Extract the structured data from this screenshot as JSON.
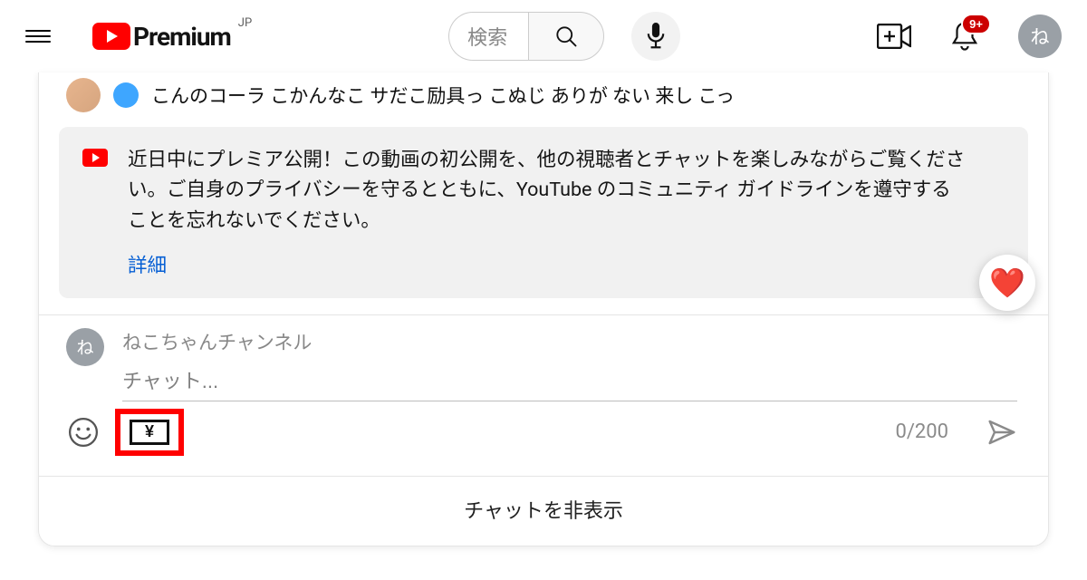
{
  "header": {
    "premium_text": "Premium",
    "region_tag": "JP",
    "search_placeholder": "検索",
    "notification_badge": "9+",
    "avatar_letter": "ね"
  },
  "chat": {
    "peek_message": "こんのコーラ こかんなこ サだこ励具っ こぬじ ありが ない 来し こっ",
    "notice_text": "近日中にプレミア公開！この動画の初公開を、他の視聴者とチャットを楽しみながらご覧ください。ご自身のプライバシーを守るとともに、YouTube のコミュニティ ガイドラインを遵守することを忘れないでください。",
    "notice_link": "詳細",
    "heart_emoji": "❤️",
    "user_name": "ねこちゃんチャンネル",
    "user_avatar_letter": "ね",
    "chat_placeholder": "チャット...",
    "counter": "0/200",
    "yen_symbol": "¥",
    "hide_chat": "チャットを非表示"
  }
}
